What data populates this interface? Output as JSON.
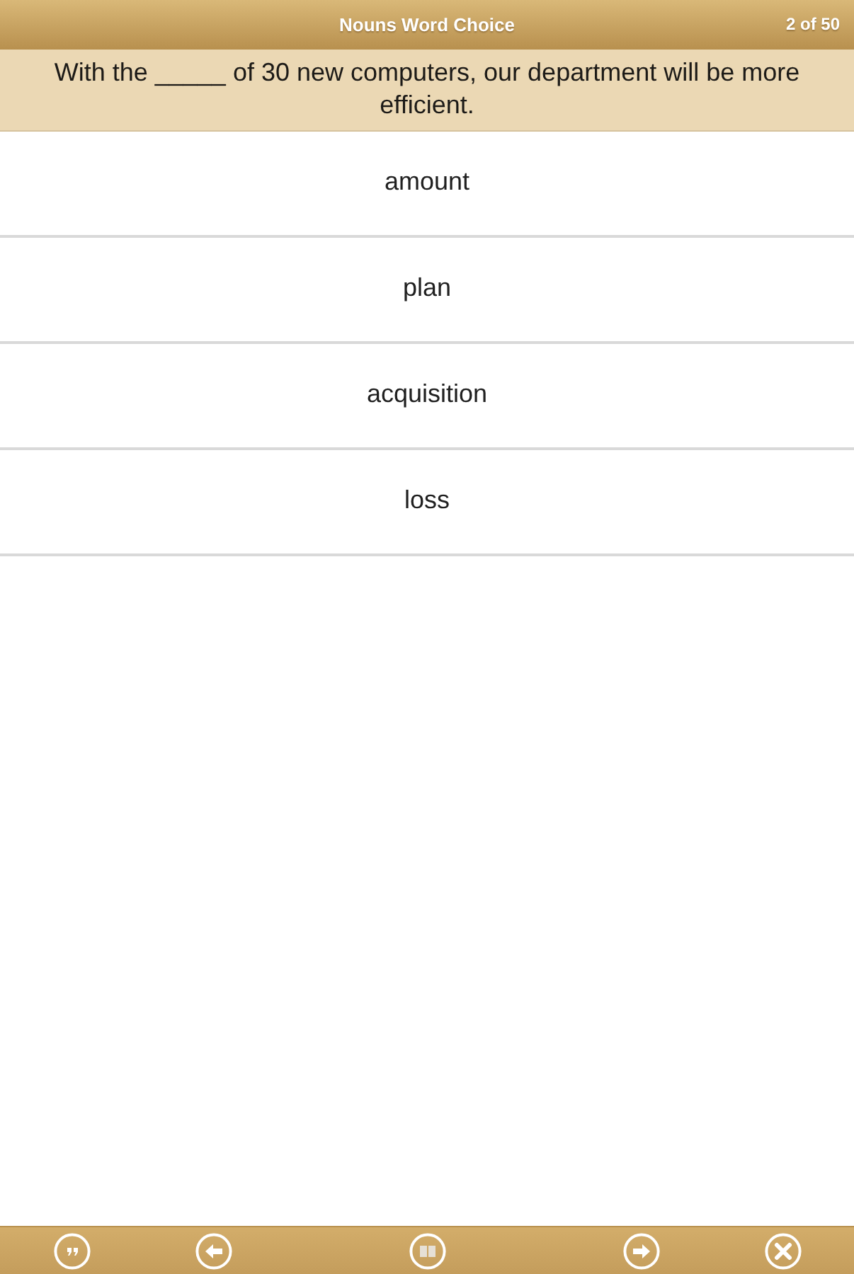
{
  "header": {
    "title": "Nouns Word Choice",
    "counter": "2 of 50"
  },
  "question": {
    "text": "With the _____ of 30 new computers, our department will be more efficient."
  },
  "options": [
    {
      "label": "amount",
      "selected": false
    },
    {
      "label": "plan",
      "selected": false
    },
    {
      "label": "acquisition",
      "selected": false
    },
    {
      "label": "loss",
      "selected": false
    }
  ]
}
